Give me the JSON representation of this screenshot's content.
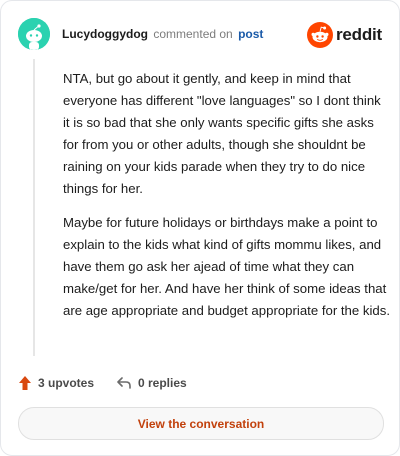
{
  "header": {
    "username": "Lucydoggydog",
    "commented_text": "commented on",
    "post_link": "post",
    "brand": "reddit"
  },
  "comment": {
    "paragraphs": [
      "NTA, but go about it gently, and keep in mind that everyone has different \"love languages\" so I dont think it is so bad that she only wants specific gifts she asks for from you or other adults, though she shouldnt be raining on your kids parade when they try to do nice things for her.",
      "Maybe for future holidays or birthdays make a point to explain to the kids what kind of gifts mommu likes, and have them go ask her ajead of time what they can make/get for her. And have her think of some ideas that are age appropriate and budget appropriate for the kids."
    ]
  },
  "actions": {
    "upvotes": "3 upvotes",
    "replies": "0 replies"
  },
  "cta": {
    "label": "View the conversation"
  },
  "colors": {
    "avatar_bg": "#2bd2b0",
    "reddit_orange": "#ff4500",
    "upvote_icon": "#d9480f",
    "link_blue": "#1a5aa8",
    "cta_text": "#c2410c"
  },
  "icons": {
    "avatar": "snoo-avatar-icon",
    "logo": "reddit-snoo-icon",
    "upvote": "upvote-arrow-icon",
    "reply": "reply-arrow-icon"
  }
}
